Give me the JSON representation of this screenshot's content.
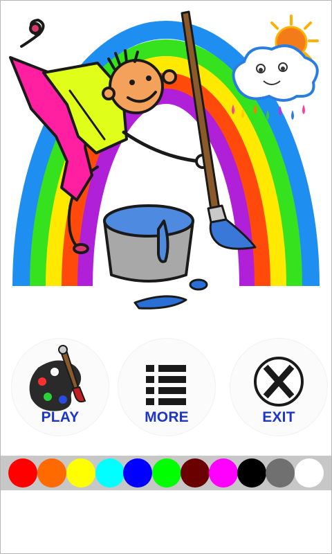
{
  "menu": {
    "play_label": "PLAY",
    "more_label": "MORE",
    "exit_label": "EXIT",
    "label_color": "#1d35c9"
  },
  "palette": {
    "colors": [
      "#ff0000",
      "#ff6a00",
      "#ffff00",
      "#00ffff",
      "#0000ff",
      "#00ff00",
      "#6b0000",
      "#ff00ff",
      "#000000",
      "#707070",
      "#ffffff"
    ]
  },
  "hero": {
    "rainbow_colors": [
      "#1e8ff0",
      "#36e21e",
      "#ffe900",
      "#ff4a0c",
      "#b020d8"
    ],
    "icons": [
      "rainbow",
      "child-painter",
      "paint-bucket",
      "paintbrush",
      "sun",
      "cloud"
    ]
  }
}
